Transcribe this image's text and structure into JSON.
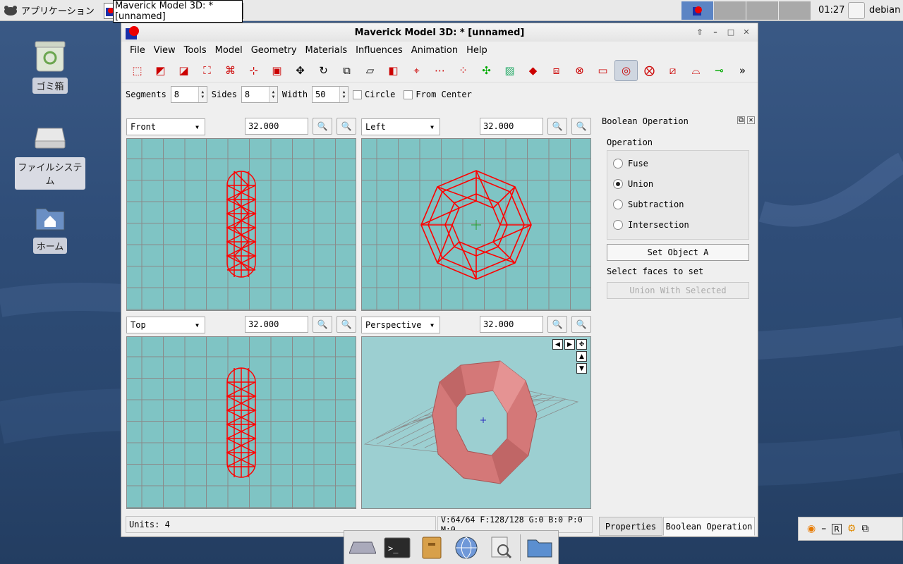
{
  "panel": {
    "apps_label": "アプリケーション",
    "task_label": "Maverick Model 3D: * [unnamed]",
    "clock": "01:27",
    "user": "debian"
  },
  "desktop": {
    "trash": "ゴミ箱",
    "filesystem": "ファイルシステム",
    "home": "ホーム"
  },
  "window": {
    "title": "Maverick Model 3D: * [unnamed]",
    "menu": [
      "File",
      "View",
      "Tools",
      "Model",
      "Geometry",
      "Materials",
      "Influences",
      "Animation",
      "Help"
    ],
    "options": {
      "segments_label": "Segments",
      "segments": "8",
      "sides_label": "Sides",
      "sides": "8",
      "width_label": "Width",
      "width": "50",
      "circle_label": "Circle",
      "from_center_label": "From Center"
    },
    "viewports": [
      {
        "view": "Front",
        "zoom": "32.000"
      },
      {
        "view": "Left",
        "zoom": "32.000"
      },
      {
        "view": "Top",
        "zoom": "32.000"
      },
      {
        "view": "Perspective",
        "zoom": "32.000"
      }
    ],
    "status": {
      "units": "Units: 4",
      "counts": "V:64/64 F:128/128 G:0 B:0 P:0 M:0"
    },
    "tabs": {
      "properties": "Properties",
      "boolean": "Boolean Operation"
    }
  },
  "boolean_panel": {
    "title": "Boolean Operation",
    "operation_label": "Operation",
    "options": [
      "Fuse",
      "Union",
      "Subtraction",
      "Intersection"
    ],
    "selected": "Union",
    "set_object_a": "Set Object A",
    "select_faces": "Select faces to set",
    "union_with_selected": "Union With Selected"
  },
  "colors": {
    "wire": "#ff0000",
    "viewport_bg": "#7fc4c4",
    "torus": "#d97a7a"
  }
}
